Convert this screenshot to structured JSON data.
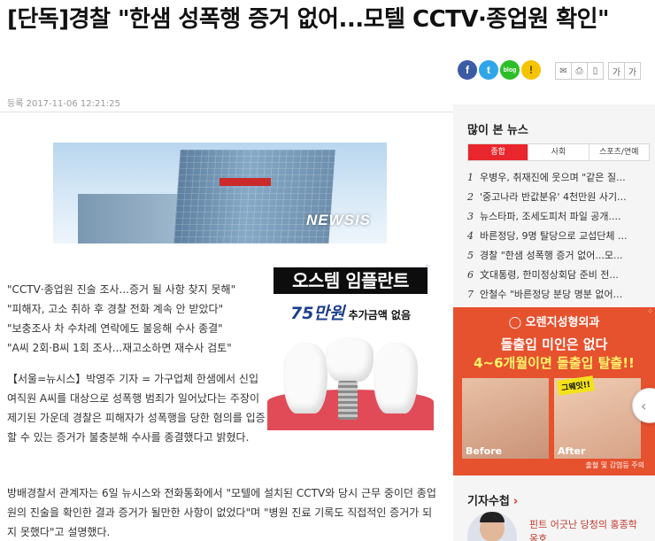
{
  "article": {
    "title": "[단독]경찰 \"한샘 성폭행 증거 없어...모텔 CCTV·종업원 확인\"",
    "date_label": "등록",
    "date": "2017-11-06 12:21:25",
    "photo_watermark": "NEWSIS",
    "summary": [
      "\"CCTV·종업원 진술 조사...증거 될 사항 찾지 못해\"",
      "\"피해자, 고소 취하 후 경찰 전화 계속 안 받았다\"",
      "\"보충조사 차 수차례 연락에도 불응해 수사 종결\"",
      "\"A씨 2회·B씨 1회 조사...재고소하면 재수사 검토\""
    ],
    "para1": "【서울=뉴시스】박영주 기자 = 가구업체 한샘에서 신입 여직원 A씨를 대상으로 성폭행 범죄가 일어났다는 주장이 제기된 가운데 경찰은 피해자가 성폭행을 당한 혐의를 입증할 수 있는 증거가 불충분해 수사를 종결했다고 밝혔다.",
    "para2": "방배경찰서 관계자는 6일 뉴시스와 전화통화에서 \"모텔에 설치된 CCTV와 당시 근무 중이던 종업원의 진술을 확인한 결과 증거가 될만한 사항이 없었다\"며 \"병원 진료 기록도 직접적인 증거가 되지 못했다\"고 설명했다."
  },
  "share": {
    "facebook": "f",
    "twitter": "t",
    "blog": "blog",
    "story": "!"
  },
  "tools": {
    "email_icon": "email-icon",
    "print_icon": "print-icon",
    "pdf_icon": "pdf-icon",
    "font_small": "가",
    "font_large": "가"
  },
  "ad1": {
    "headline": "오스템 임플란트",
    "price": "75만원",
    "subline": "추가금액 없음"
  },
  "sidebar": {
    "title": "많이 본 뉴스",
    "tabs": [
      "종합",
      "사회",
      "스포츠/연예"
    ],
    "items": [
      {
        "num": "1",
        "text": "우병우, 취재진에 웃으며 \"같은 질..."
      },
      {
        "num": "2",
        "text": "'중고나라 반값분유' 4천만원 사기..."
      },
      {
        "num": "3",
        "text": "뉴스타파, 조세도피처 파일 공개...."
      },
      {
        "num": "4",
        "text": "바른정당, 9명 탈당으로 교섭단체 ..."
      },
      {
        "num": "5",
        "text": "경찰 \"한샘 성폭행 증거 없어...모..."
      },
      {
        "num": "6",
        "text": "文대통령, 한미정상회담 준비 전..."
      },
      {
        "num": "7",
        "text": "안철수 \"바른정당 분당 명분 없어..."
      }
    ]
  },
  "ad2": {
    "brand": "오렌지성형외과",
    "line1": "돌출입 미인은 없다",
    "line2": "4~6개월이면 돌출입 탈출!!",
    "before": "Before",
    "after": "After",
    "badge": "그웨잇!!",
    "footer": "출혈 및 감염등 주의"
  },
  "reporter": {
    "heading": "기자수첩",
    "arrow": "›",
    "text": "핀트 어긋난 당청의 홍종학 옹호"
  },
  "colors": {
    "accent_red": "#e8262b",
    "facebook": "#3b5ba4",
    "twitter": "#2fa6e8",
    "blog": "#2dbd28",
    "story": "#f5c400",
    "ad2_bg": "#e6512e"
  }
}
